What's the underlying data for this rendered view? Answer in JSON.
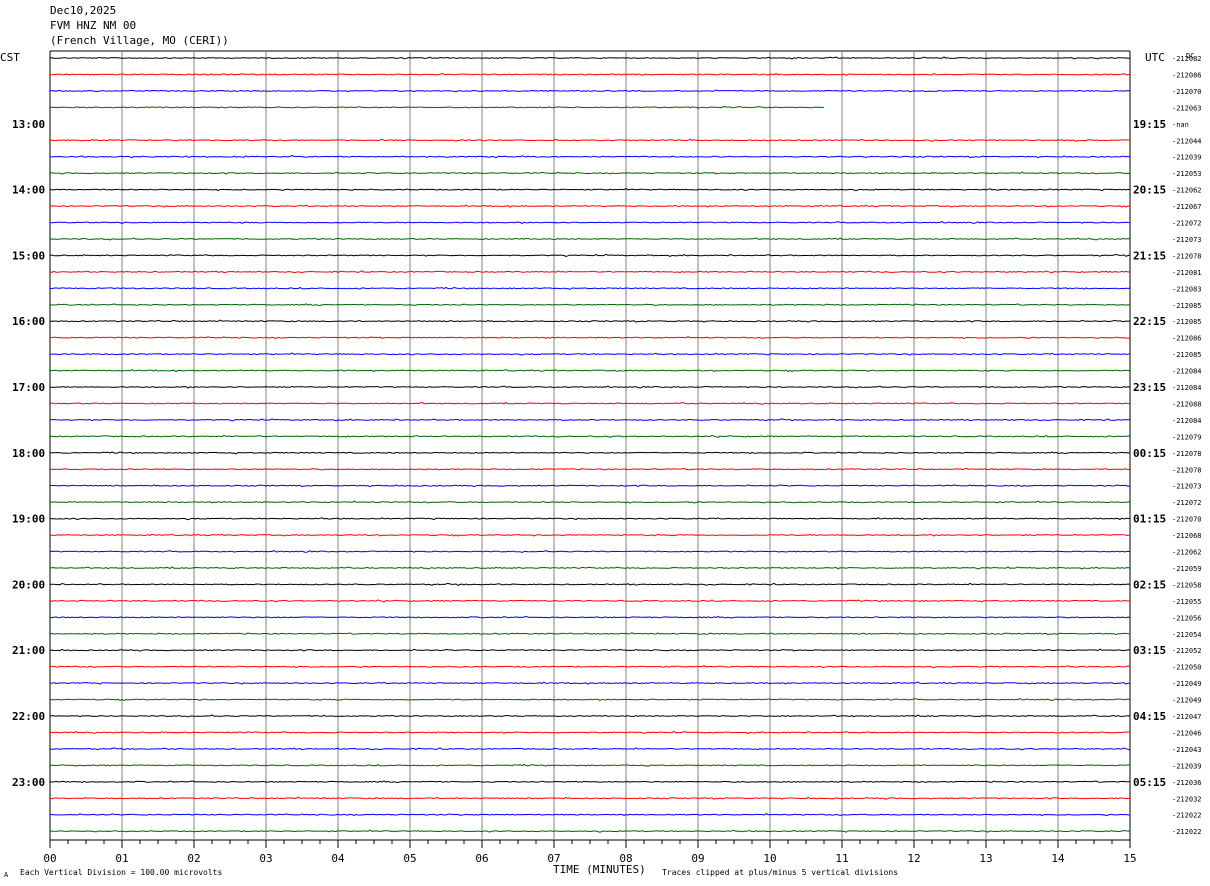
{
  "header": {
    "date": "Dec10,2025",
    "station": "FVM HNZ NM 00",
    "location": "(French Village, MO (CERI))"
  },
  "left_tz": "CST",
  "right_tz": "UTC",
  "dc_label": "DC",
  "footer": {
    "left": "Each Vertical Division =  100.00 microvolts",
    "center": "TIME (MINUTES)",
    "right": "Traces clipped at plus/minus 5 vertical divisions",
    "corner": "A"
  },
  "colors": {
    "trace_cycle": [
      "#000000",
      "#ff0000",
      "#0000ff",
      "#006400"
    ],
    "grid": "#808080"
  },
  "chart_data": {
    "type": "line",
    "title": "FVM HNZ NM 00",
    "xlabel": "TIME (MINUTES)",
    "x_ticks": [
      "00",
      "01",
      "02",
      "03",
      "04",
      "05",
      "06",
      "07",
      "08",
      "09",
      "10",
      "11",
      "12",
      "13",
      "14",
      "15"
    ],
    "xlim": [
      0,
      15
    ],
    "minutes_per_row": 15,
    "row_count": 48,
    "left_hour_labels": [
      "13:00",
      "14:00",
      "15:00",
      "16:00",
      "17:00",
      "18:00",
      "19:00",
      "20:00",
      "21:00",
      "22:00",
      "23:00"
    ],
    "right_hour_labels": [
      "19:15",
      "20:15",
      "21:15",
      "22:15",
      "23:15",
      "00:15",
      "01:15",
      "02:15",
      "03:15",
      "04:15",
      "05:15"
    ],
    "row_dc_values": [
      "-212082",
      "-212086",
      "-212070",
      "-212063",
      "-nan",
      "-212044",
      "-212039",
      "-212053",
      "-212062",
      "-212067",
      "-212072",
      "-212073",
      "-212078",
      "-212081",
      "-212083",
      "-212085",
      "-212085",
      "-212086",
      "-212085",
      "-212084",
      "-212084",
      "-212088",
      "-212084",
      "-212079",
      "-212078",
      "-212078",
      "-212073",
      "-212072",
      "-212070",
      "-212068",
      "-212062",
      "-212059",
      "-212058",
      "-212055",
      "-212056",
      "-212054",
      "-212052",
      "-212050",
      "-212049",
      "-212049",
      "-212047",
      "-212046",
      "-212043",
      "-212039",
      "-212036",
      "-212032",
      "-212022",
      "-212022"
    ],
    "data_end_minute": {
      "row": 3,
      "minute": 10.75
    },
    "missing_rows": [
      4
    ]
  }
}
